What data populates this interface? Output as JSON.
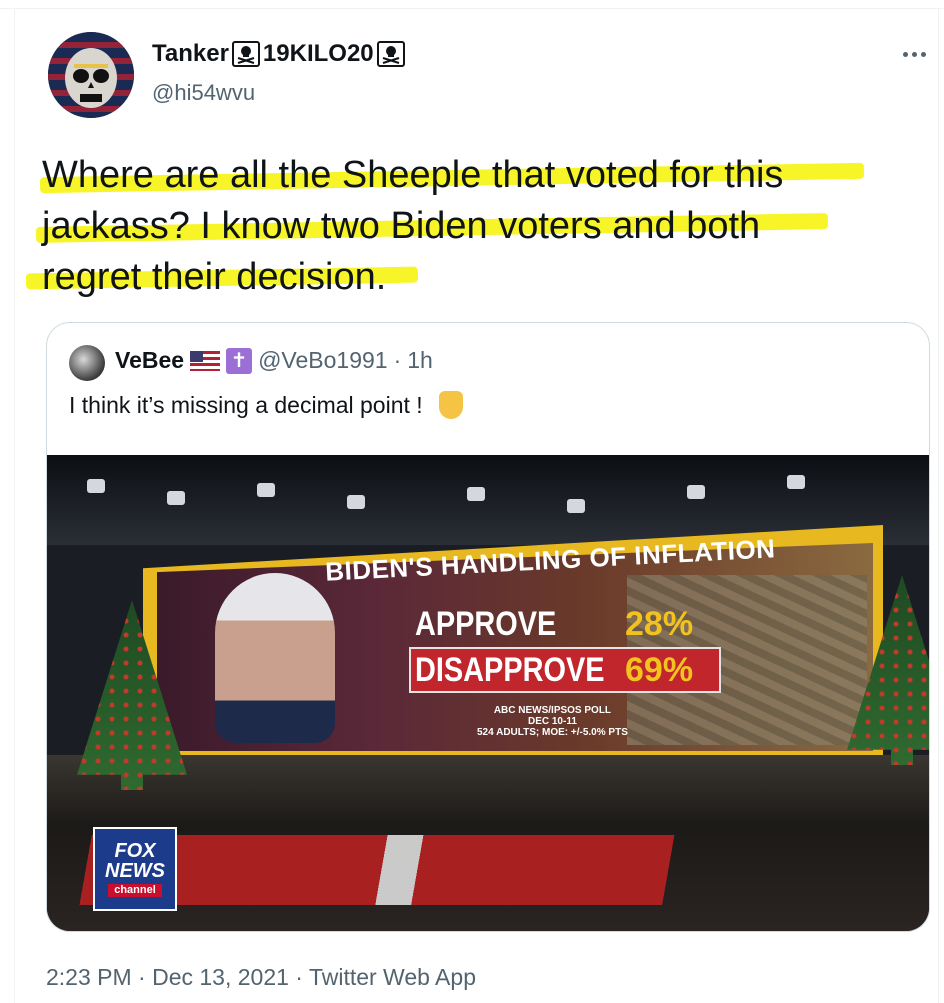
{
  "tweet": {
    "author": {
      "name": "Tanker",
      "name_suffix": "19KILO20",
      "handle": "@hi54wvu"
    },
    "text": {
      "line1": "Where are all the Sheeple that voted for this",
      "line2": "jackass? I know two Biden voters and both",
      "line3": "regret their decision."
    },
    "highlight_color": "#f7f41c",
    "timestamp": "2:23 PM · Dec 13, 2021 · Twitter Web App"
  },
  "quote": {
    "author": {
      "name": "VeBee",
      "handle": "@VeBo1991",
      "separator": "·",
      "time": "1h"
    },
    "text": "I think it’s missing a decimal point !",
    "graphic": {
      "title": "BIDEN'S HANDLING OF INFLATION",
      "approve_label": "APPROVE",
      "approve_value": "28%",
      "disapprove_label": "DISAPPROVE",
      "disapprove_value": "69%",
      "source_line1": "ABC NEWS/IPSOS POLL",
      "source_line2": "DEC 10-11",
      "source_line3": "524 ADULTS; MOE: +/-5.0% PTS",
      "logo_line1": "FOX",
      "logo_line2": "NEWS",
      "logo_line3": "channel"
    }
  },
  "icons": {
    "more": "more-horizontal-icon",
    "skull": "skull-crossbones-icon",
    "flag": "us-flag-icon",
    "cross": "latin-cross-icon",
    "finger": "pointing-down-icon"
  },
  "colors": {
    "text": "#0f1419",
    "secondary": "#536471",
    "border": "#cfd9de"
  }
}
